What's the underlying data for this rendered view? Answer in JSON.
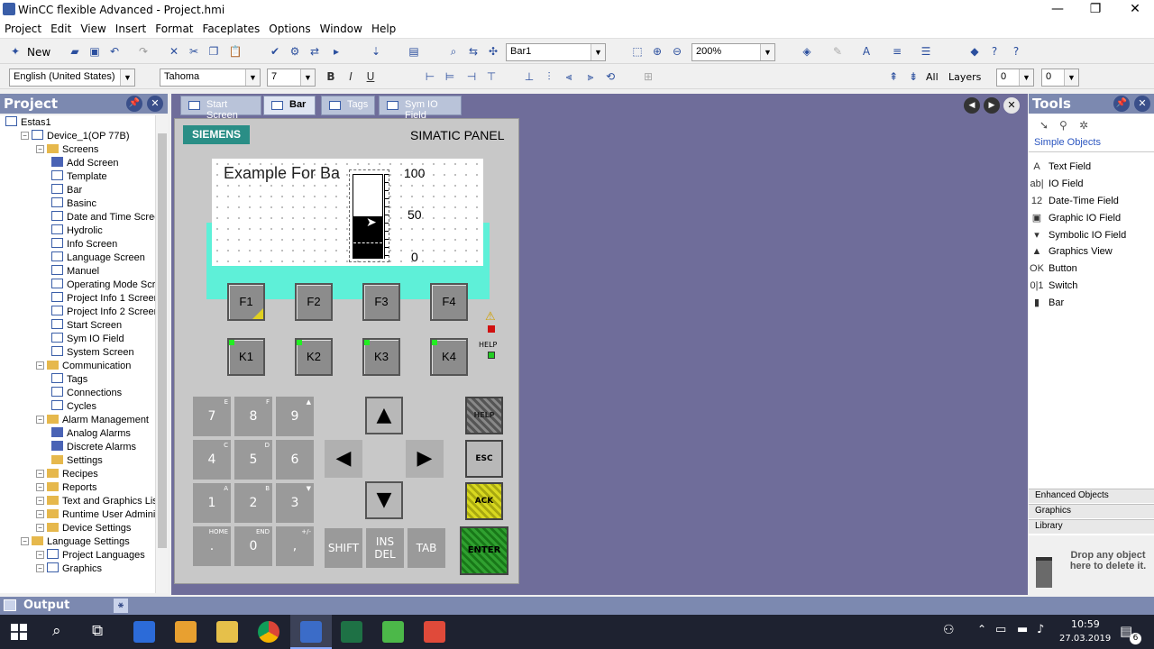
{
  "window": {
    "title": "WinCC flexible Advanced - Project.hmi",
    "min": "—",
    "max": "❐",
    "close": "✕"
  },
  "menu": [
    "Project",
    "Edit",
    "View",
    "Insert",
    "Format",
    "Faceplates",
    "Options",
    "Window",
    "Help"
  ],
  "toolbar1": {
    "new_label": "New",
    "object_combo": "Bar1",
    "zoom_combo": "200%"
  },
  "toolbar2": {
    "language_combo": "English (United States)",
    "font_combo": "Tahoma",
    "size_combo": "7",
    "bold": "B",
    "italic": "I",
    "underline": "U",
    "all_label": "All",
    "layers_label": "Layers",
    "layer_from": "0",
    "layer_to": "0"
  },
  "project": {
    "header": "Project",
    "tree": [
      {
        "label": "Estas1",
        "level": 0,
        "icon": "project-icon"
      },
      {
        "label": "Device_1(OP 77B)",
        "level": 1,
        "icon": "device-icon"
      },
      {
        "label": "Screens",
        "level": 2,
        "icon": "folder-icon"
      },
      {
        "label": "Add Screen",
        "level": 3,
        "icon": "add-screen-icon"
      },
      {
        "label": "Template",
        "level": 3,
        "icon": "template-icon"
      },
      {
        "label": "Bar",
        "level": 3,
        "icon": "screen-icon"
      },
      {
        "label": "Basinc",
        "level": 3,
        "icon": "screen-icon"
      },
      {
        "label": "Date and Time Scree",
        "level": 3,
        "icon": "screen-icon"
      },
      {
        "label": "Hydrolic",
        "level": 3,
        "icon": "screen-icon"
      },
      {
        "label": "Info Screen",
        "level": 3,
        "icon": "screen-icon"
      },
      {
        "label": "Language Screen",
        "level": 3,
        "icon": "screen-icon"
      },
      {
        "label": "Manuel",
        "level": 3,
        "icon": "screen-icon"
      },
      {
        "label": "Operating Mode Scre",
        "level": 3,
        "icon": "screen-icon"
      },
      {
        "label": "Project Info 1 Screen",
        "level": 3,
        "icon": "screen-icon"
      },
      {
        "label": "Project Info 2 Screen",
        "level": 3,
        "icon": "screen-icon"
      },
      {
        "label": "Start Screen",
        "level": 3,
        "icon": "screen-icon"
      },
      {
        "label": "Sym IO Field",
        "level": 3,
        "icon": "screen-icon"
      },
      {
        "label": "System Screen",
        "level": 3,
        "icon": "screen-icon"
      },
      {
        "label": "Communication",
        "level": 2,
        "icon": "folder-icon"
      },
      {
        "label": "Tags",
        "level": 3,
        "icon": "tags-icon"
      },
      {
        "label": "Connections",
        "level": 3,
        "icon": "connections-icon"
      },
      {
        "label": "Cycles",
        "level": 3,
        "icon": "cycles-icon"
      },
      {
        "label": "Alarm Management",
        "level": 2,
        "icon": "folder-icon"
      },
      {
        "label": "Analog Alarms",
        "level": 3,
        "icon": "analog-alarms-icon"
      },
      {
        "label": "Discrete Alarms",
        "level": 3,
        "icon": "discrete-alarms-icon"
      },
      {
        "label": "Settings",
        "level": 3,
        "icon": "settings-folder-icon"
      },
      {
        "label": "Recipes",
        "level": 2,
        "icon": "folder-icon"
      },
      {
        "label": "Reports",
        "level": 2,
        "icon": "folder-icon"
      },
      {
        "label": "Text and Graphics Lists",
        "level": 2,
        "icon": "folder-icon"
      },
      {
        "label": "Runtime User Administrat",
        "level": 2,
        "icon": "folder-icon"
      },
      {
        "label": "Device Settings",
        "level": 2,
        "icon": "folder-icon"
      },
      {
        "label": "Language Settings",
        "level": 1,
        "icon": "folder-icon"
      },
      {
        "label": "Project Languages",
        "level": 2,
        "icon": "languages-icon"
      },
      {
        "label": "Graphics",
        "level": 2,
        "icon": "graphics-icon"
      }
    ]
  },
  "tabs": [
    {
      "label": "Start Screen",
      "active": false
    },
    {
      "label": "Bar",
      "active": true
    },
    {
      "label": "Tags",
      "active": false
    },
    {
      "label": "Sym IO Field",
      "active": false
    }
  ],
  "panel": {
    "brand": "SIEMENS",
    "model": "SIMATIC PANEL",
    "screen_text": "Example For Ba",
    "scale": [
      "100",
      "50",
      "0"
    ],
    "bar_fill_fraction": 0.5,
    "fkeys": [
      "F1",
      "F2",
      "F3",
      "F4"
    ],
    "kkeys": [
      "K1",
      "K2",
      "K3",
      "K4"
    ],
    "help_label": "HELP",
    "numpad": [
      {
        "main": "7",
        "sub": "E"
      },
      {
        "main": "8",
        "sub": "F"
      },
      {
        "main": "9",
        "sub": "▲"
      },
      {
        "main": "4",
        "sub": "C"
      },
      {
        "main": "5",
        "sub": "D"
      },
      {
        "main": "6",
        "sub": ""
      },
      {
        "main": "1",
        "sub": "A"
      },
      {
        "main": "2",
        "sub": "B"
      },
      {
        "main": "3",
        "sub": "▼"
      },
      {
        "main": ".",
        "sub": "HOME"
      },
      {
        "main": "0",
        "sub": "END"
      },
      {
        "main": ",",
        "sub": "+/-"
      }
    ],
    "shift": "SHIFT",
    "insdel": "INS\nDEL",
    "tab": "TAB",
    "helpkey": "HELP",
    "esc": "ESC",
    "ack": "ACK",
    "enter": "ENTER"
  },
  "tools": {
    "header": "Tools",
    "group_label": "Simple Objects",
    "items": [
      {
        "label": "Text Field",
        "icon": "A"
      },
      {
        "label": "IO Field",
        "icon": "ab|"
      },
      {
        "label": "Date-Time Field",
        "icon": "12"
      },
      {
        "label": "Graphic IO Field",
        "icon": "▣"
      },
      {
        "label": "Symbolic IO Field",
        "icon": "▾"
      },
      {
        "label": "Graphics View",
        "icon": "▲"
      },
      {
        "label": "Button",
        "icon": "OK"
      },
      {
        "label": "Switch",
        "icon": "0|1"
      },
      {
        "label": "Bar",
        "icon": "▮"
      }
    ],
    "sections": [
      "Enhanced Objects",
      "Graphics",
      "Library"
    ],
    "drop_text": "Drop any object here to delete it."
  },
  "output": {
    "label": "Output"
  },
  "taskbar": {
    "time": "10:59",
    "date": "27.03.2019",
    "notif_count": "6"
  }
}
